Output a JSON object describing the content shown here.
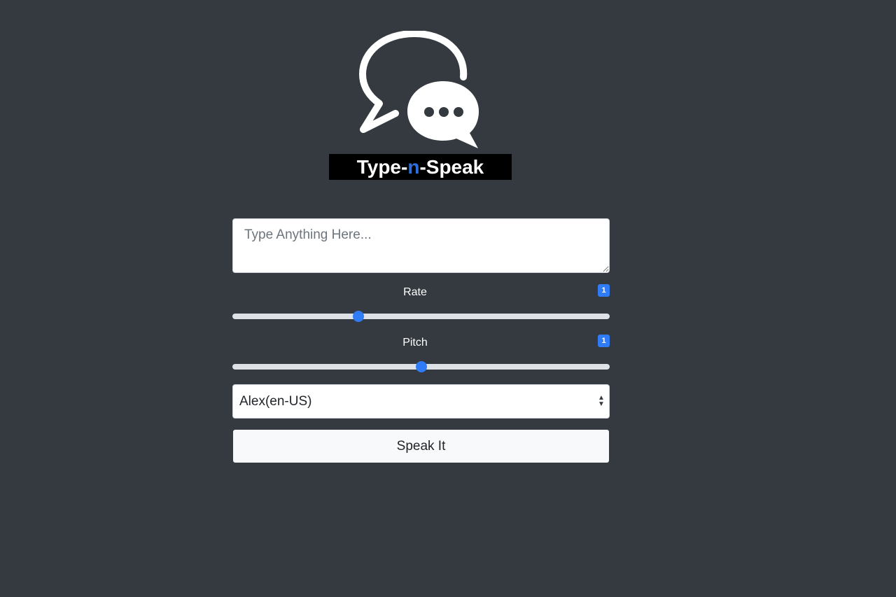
{
  "logo": {
    "text_before": "Type-",
    "text_accent": "n",
    "text_after": "-Speak",
    "icon": "chat-bubbles-icon",
    "accent_color": "#2f6fdb"
  },
  "input": {
    "placeholder": "Type Anything Here...",
    "value": ""
  },
  "rate": {
    "label": "Rate",
    "badge": "1",
    "value": 1,
    "min": 0.5,
    "max": 2
  },
  "pitch": {
    "label": "Pitch",
    "badge": "1",
    "value": 1,
    "min": 0,
    "max": 2
  },
  "voice_select": {
    "selected": "Alex(en-US)"
  },
  "speak_button": {
    "label": "Speak It"
  },
  "colors": {
    "background": "#343a40",
    "accent": "#2f7cf6"
  }
}
